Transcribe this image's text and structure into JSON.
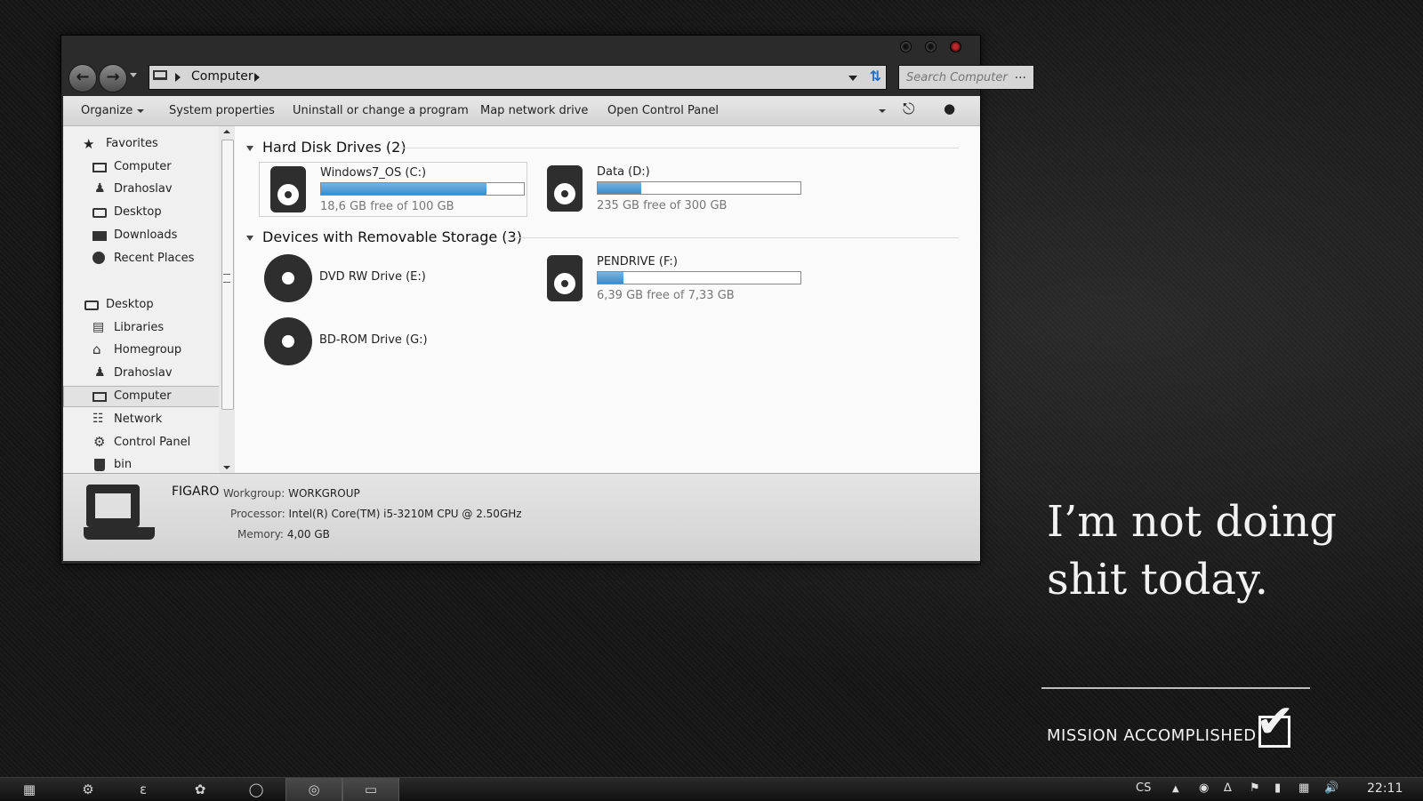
{
  "explorer": {
    "nav": {
      "back_icon": "back-arrow-icon",
      "forward_icon": "forward-arrow-icon"
    },
    "address": {
      "crumb": "Computer"
    },
    "search": {
      "placeholder": "Search Computer",
      "more": "..."
    },
    "toolbar": {
      "organize": "Organize",
      "system_properties": "System properties",
      "uninstall": "Uninstall or change a program",
      "map_drive": "Map network drive",
      "control_panel": "Open Control Panel"
    },
    "sidebar": {
      "favorites": [
        {
          "label": "Favorites",
          "icon": "star-icon"
        },
        {
          "label": "Computer",
          "icon": "computer-icon"
        },
        {
          "label": "Drahoslav",
          "icon": "user-icon"
        },
        {
          "label": "Desktop",
          "icon": "desktop-icon"
        },
        {
          "label": "Downloads",
          "icon": "folder-icon"
        },
        {
          "label": "Recent Places",
          "icon": "recent-icon"
        }
      ],
      "tree": [
        {
          "label": "Desktop",
          "icon": "desktop-icon"
        },
        {
          "label": "Libraries",
          "icon": "libraries-icon"
        },
        {
          "label": "Homegroup",
          "icon": "home-icon"
        },
        {
          "label": "Drahoslav",
          "icon": "user-icon"
        },
        {
          "label": "Computer",
          "icon": "computer-icon",
          "selected": true
        },
        {
          "label": "Network",
          "icon": "network-icon"
        },
        {
          "label": "Control Panel",
          "icon": "gear-icon"
        },
        {
          "label": "bin",
          "icon": "trash-icon"
        }
      ]
    },
    "groups": {
      "hdd": {
        "title": "Hard Disk Drives (2)",
        "drives": [
          {
            "name": "Windows7_OS (C:)",
            "free": "18,6 GB free of 100 GB",
            "used_fraction": 0.814
          },
          {
            "name": "Data (D:)",
            "free": "235 GB free of 300 GB",
            "used_fraction": 0.217
          }
        ]
      },
      "removable": {
        "title": "Devices with Removable Storage (3)",
        "drives": [
          {
            "name": "DVD RW Drive (E:)"
          },
          {
            "name": "PENDRIVE (F:)",
            "free": "6,39 GB free of 7,33 GB",
            "used_fraction": 0.128
          },
          {
            "name": "BD-ROM Drive (G:)"
          }
        ]
      }
    },
    "details": {
      "computer_name": "FIGARO",
      "workgroup_label": "Workgroup:",
      "workgroup": "WORKGROUP",
      "processor_label": "Processor:",
      "processor": "Intel(R) Core(TM) i5-3210M CPU @ 2.50GHz",
      "memory_label": "Memory:",
      "memory": "4,00 GB"
    }
  },
  "wallpaper": {
    "quote": "I’m not doing shit today.",
    "mission": "MISSION ACCOMPLISHED"
  },
  "taskbar": {
    "language": "CS",
    "clock": "22:11"
  }
}
